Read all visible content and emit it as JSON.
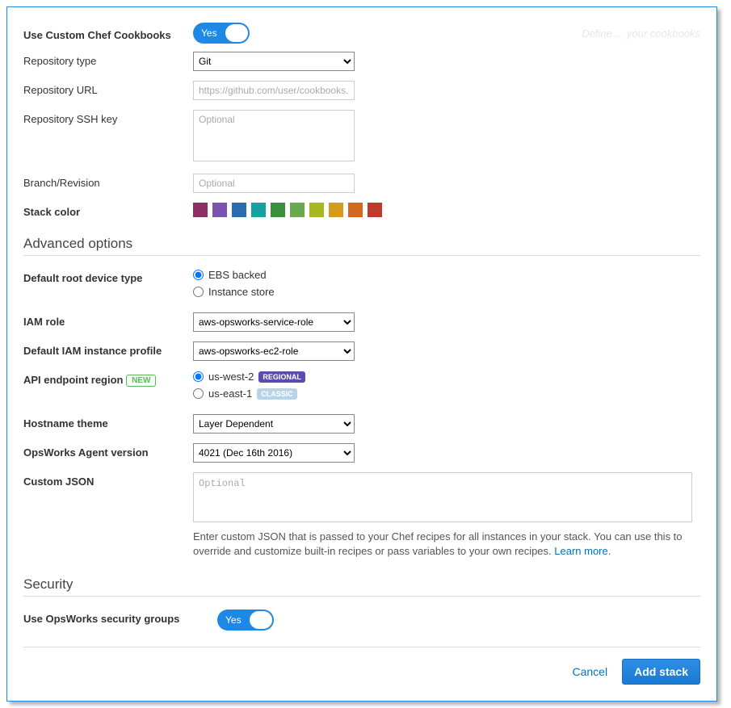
{
  "top": {
    "use_cookbooks_label": "Use Custom Chef Cookbooks",
    "use_cookbooks_value": "Yes",
    "hint": "Define ... your cookbooks"
  },
  "chef": {
    "repo_type_label": "Repository type",
    "repo_type_value": "Git",
    "repo_url_label": "Repository URL",
    "repo_url_placeholder": "https://github.com/user/cookbooks.git",
    "ssh_key_label": "Repository SSH key",
    "ssh_key_placeholder": "Optional",
    "branch_label": "Branch/Revision",
    "branch_placeholder": "Optional",
    "stack_color_label": "Stack color",
    "colors": [
      "#8e2f63",
      "#7a54b0",
      "#2b6cb0",
      "#17a2a2",
      "#3a8f3a",
      "#6aa84f",
      "#a8b820",
      "#d49b1d",
      "#d2691e",
      "#c0392b"
    ]
  },
  "advanced": {
    "heading": "Advanced options",
    "root_device_label": "Default root device type",
    "root_ebs": "EBS backed",
    "root_instance": "Instance store",
    "iam_role_label": "IAM role",
    "iam_role_value": "aws-opsworks-service-role",
    "iam_profile_label": "Default IAM instance profile",
    "iam_profile_value": "aws-opsworks-ec2-role",
    "api_region_label": "API endpoint region",
    "new_badge": "NEW",
    "region_west": "us-west-2",
    "regional_badge": "REGIONAL",
    "region_east": "us-east-1",
    "classic_badge": "CLASSIC",
    "hostname_label": "Hostname theme",
    "hostname_value": "Layer Dependent",
    "agent_label": "OpsWorks Agent version",
    "agent_value": "4021 (Dec 16th 2016)",
    "custom_json_label": "Custom JSON",
    "custom_json_placeholder": "Optional",
    "custom_json_help1": "Enter custom JSON that is passed to your Chef recipes for all instances in your stack. You can use this to override and customize built-in recipes or pass variables to your own recipes. ",
    "learn_more": "Learn more"
  },
  "security": {
    "heading": "Security",
    "use_sg_label": "Use OpsWorks security groups",
    "use_sg_value": "Yes"
  },
  "footer": {
    "cancel": "Cancel",
    "add": "Add stack"
  }
}
